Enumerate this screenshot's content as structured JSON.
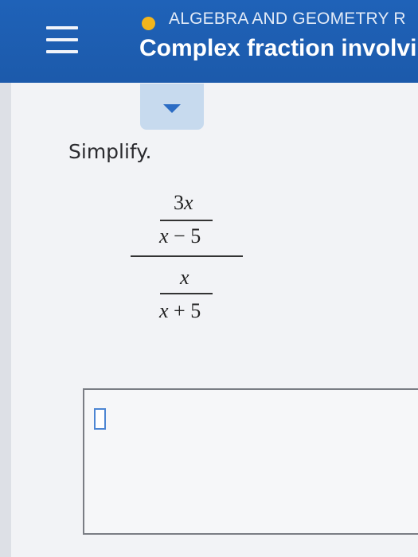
{
  "header": {
    "course": "ALGEBRA AND GEOMETRY R",
    "topic": "Complex fraction involvin",
    "status_color": "#f2b51c",
    "menu_icon": "hamburger-menu-icon"
  },
  "panel": {
    "toggle_icon": "chevron-down-icon"
  },
  "problem": {
    "instruction": "Simplify.",
    "numerator": {
      "numerator": {
        "coef": "3",
        "var": "x"
      },
      "denominator": {
        "var": "x",
        "op": "−",
        "const": "5"
      }
    },
    "denominator": {
      "numerator": {
        "var": "x"
      },
      "denominator": {
        "var": "x",
        "op": "+",
        "const": "5"
      }
    }
  },
  "answer": {
    "value": ""
  },
  "colors": {
    "header_bg": "#1f62b8",
    "accent": "#2b6cc4",
    "tab_bg": "#c7daee"
  }
}
